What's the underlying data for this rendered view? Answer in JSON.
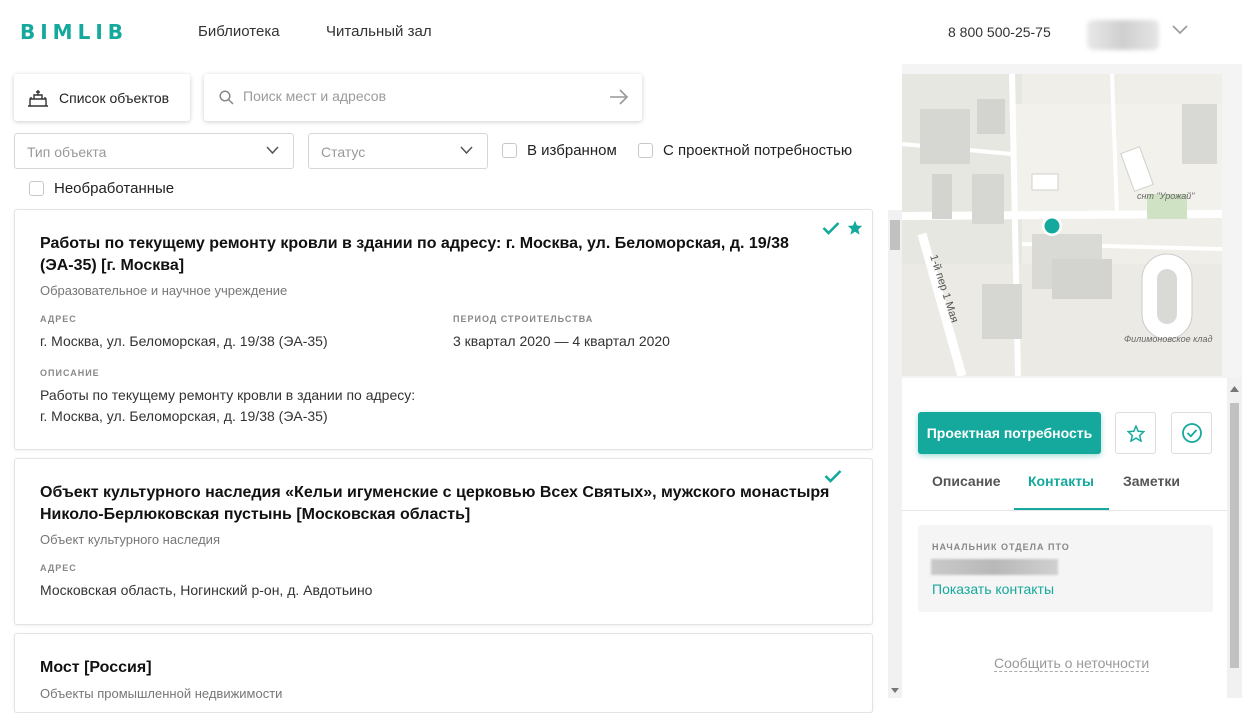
{
  "header": {
    "logo": "BIMLIB",
    "nav": [
      "Библиотека",
      "Читальный зал"
    ],
    "phone": "8 800 500-25-75"
  },
  "toolbar": {
    "list_button": "Список объектов",
    "search_placeholder": "Поиск мест и адресов"
  },
  "filters": {
    "type_placeholder": "Тип объекта",
    "status_placeholder": "Статус",
    "favorites": "В избранном",
    "project_need": "С проектной потребностью",
    "unprocessed": "Необработанные"
  },
  "cards": [
    {
      "title": "Работы по текущему ремонту кровли в здании по адресу: г. Москва, ул. Беломорская, д. 19/38 (ЭА-35) [г. Москва]",
      "type": "Образовательное и научное учреждение",
      "address_label": "АДРЕС",
      "address": "г. Москва, ул. Беломорская, д. 19/38 (ЭА-35)",
      "period_label": "ПЕРИОД СТРОИТЕЛЬСТВА",
      "period": "3 квартал 2020 — 4 квартал 2020",
      "description_label": "ОПИСАНИЕ",
      "description_line1": "Работы по текущему ремонту кровли в здании по адресу:",
      "description_line2": "г. Москва, ул. Беломорская, д. 19/38 (ЭА-35)"
    },
    {
      "title": "Объект культурного наследия «Кельи игуменские с церковью Всех Святых», мужского монастыря Николо-Берлюковская пустынь [Московская область]",
      "type": "Объект культурного наследия",
      "address_label": "АДРЕС",
      "address": "Московская область, Ногинский р-он, д. Авдотьино"
    },
    {
      "title": "Мост [Россия]",
      "type": "Объекты промышленной недвижимости"
    }
  ],
  "map": {
    "labels": [
      "снт \"Урожай\"",
      "1-й пер 1 Мая",
      "Филимоновское клад"
    ]
  },
  "panel": {
    "primary_button": "Проектная потребность",
    "tabs": [
      "Описание",
      "Контакты",
      "Заметки"
    ],
    "active_tab": "Контакты",
    "contact_role": "НАЧАЛЬНИК ОТДЕЛА ПТО",
    "show_contacts": "Показать контакты",
    "report": "Сообщить о неточности"
  },
  "colors": {
    "accent": "#14a99c"
  }
}
